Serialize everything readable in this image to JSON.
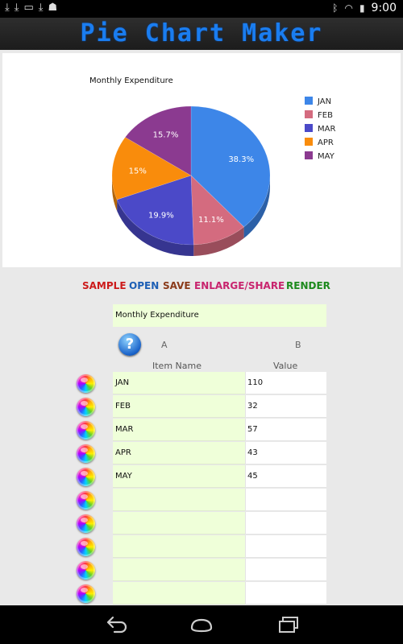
{
  "status_bar": {
    "time": "9:00",
    "icons": [
      "download-icon",
      "download-icon",
      "sd-card-icon",
      "download-icon",
      "android-icon",
      "bluetooth-icon",
      "wifi-icon",
      "battery-icon"
    ]
  },
  "app": {
    "title": "Pie Chart Maker"
  },
  "chart_data": {
    "type": "pie",
    "title": "Monthly Expenditure",
    "categories": [
      "JAN",
      "FEB",
      "MAR",
      "APR",
      "MAY"
    ],
    "values": [
      110,
      32,
      57,
      43,
      45
    ],
    "labels": [
      "38.3%",
      "11.1%",
      "19.9%",
      "15%",
      "15.7%"
    ],
    "colors": [
      "#3d86e8",
      "#d46b7f",
      "#4b49c8",
      "#f98c0c",
      "#8b3a90"
    ],
    "legend_position": "right"
  },
  "toolbar": {
    "sample": "SAMPLE",
    "sample_color": "#cc1b1b",
    "open": "OPEN",
    "open_color": "#1d5fb5",
    "save": "SAVE",
    "save_color": "#8a3a1a",
    "share": "ENLARGE/SHARE",
    "share_color": "#c8246e",
    "render": "RENDER",
    "render_color": "#1d8a1d"
  },
  "table": {
    "title": "Monthly Expenditure",
    "col_a": "A",
    "col_b": "B",
    "header_name": "Item Name",
    "header_value": "Value",
    "rows": [
      {
        "name": "JAN",
        "value": "110"
      },
      {
        "name": "FEB",
        "value": "32"
      },
      {
        "name": "MAR",
        "value": "57"
      },
      {
        "name": "APR",
        "value": "43"
      },
      {
        "name": "MAY",
        "value": "45"
      },
      {
        "name": "",
        "value": ""
      },
      {
        "name": "",
        "value": ""
      },
      {
        "name": "",
        "value": ""
      },
      {
        "name": "",
        "value": ""
      },
      {
        "name": "",
        "value": ""
      }
    ]
  },
  "nav_bar": {
    "icons": [
      "back-icon",
      "home-icon",
      "recent-apps-icon"
    ]
  }
}
